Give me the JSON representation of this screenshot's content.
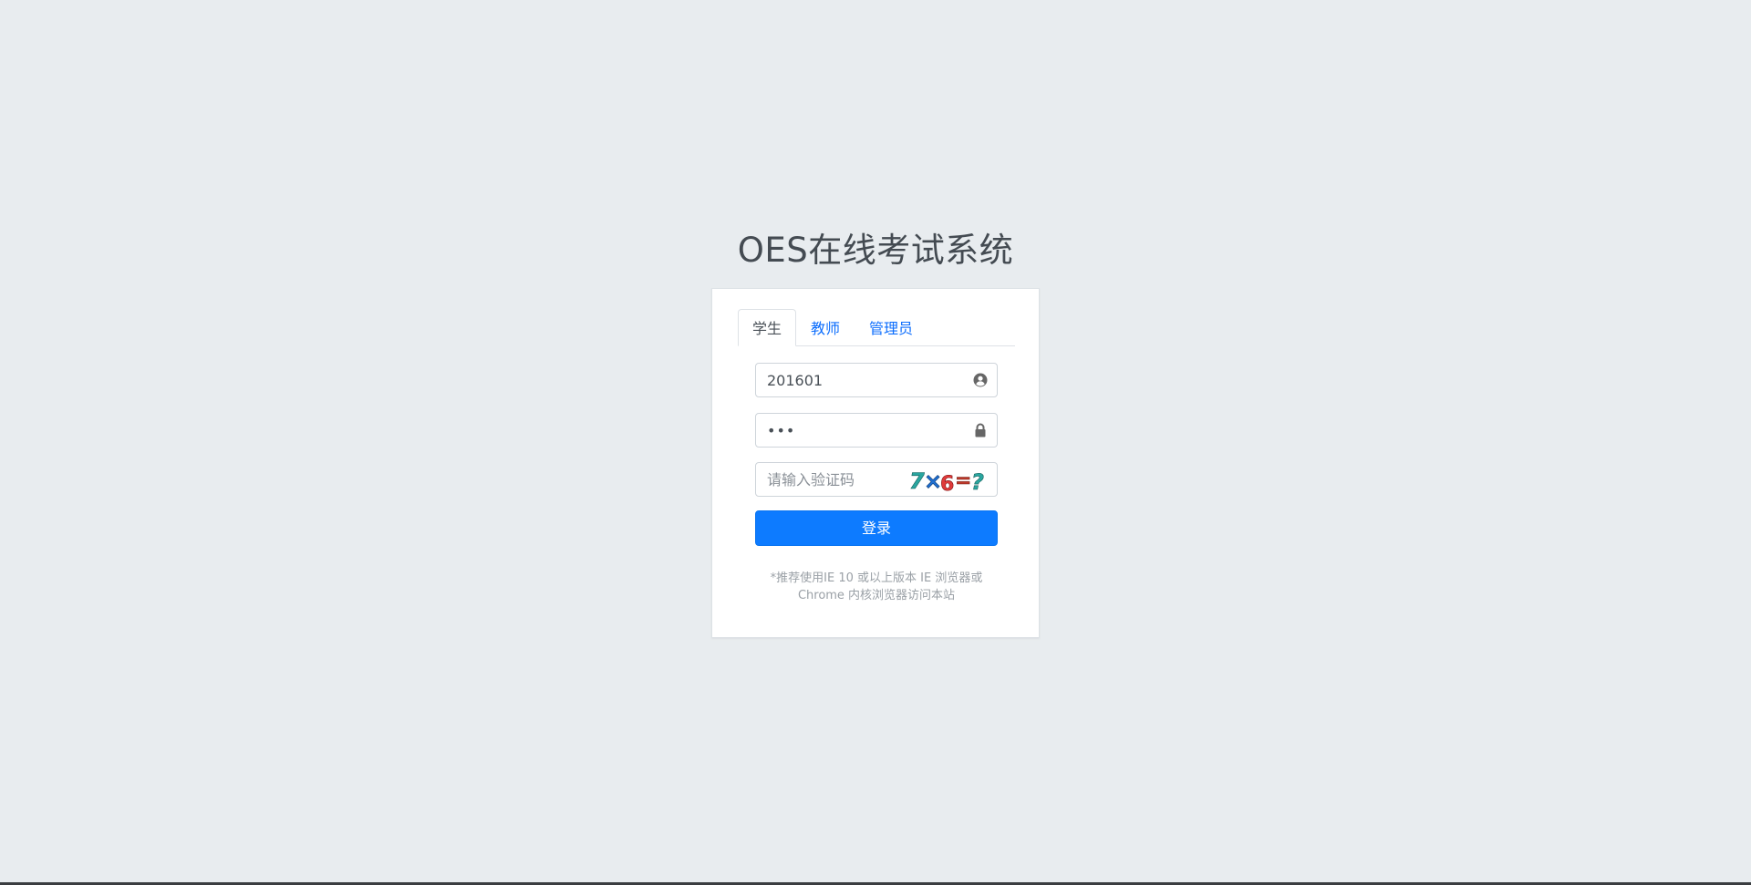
{
  "app": {
    "title": "OES在线考试系统"
  },
  "tabs": [
    {
      "label": "学生",
      "active": true
    },
    {
      "label": "教师",
      "active": false
    },
    {
      "label": "管理员",
      "active": false
    }
  ],
  "form": {
    "username": {
      "value": "201601",
      "icon": "user-circle-icon"
    },
    "password": {
      "value": "•••",
      "icon": "lock-icon"
    },
    "captcha": {
      "placeholder": "请输入验证码",
      "value": "",
      "image_text": "7×6=?"
    },
    "login_label": "登录"
  },
  "note": {
    "line1": "*推荐使用IE 10 或以上版本 IE 浏览器或",
    "line2": "Chrome 内核浏览器访问本站"
  },
  "colors": {
    "background": "#e8ecef",
    "primary": "#0d7bff",
    "active_tab_text": "#495057",
    "link": "#0d6efd"
  }
}
